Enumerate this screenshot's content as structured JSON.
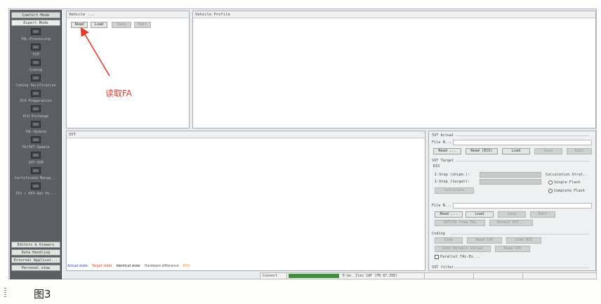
{
  "nav": {
    "modes": [
      "Comfort Mode",
      "Expert Mode"
    ],
    "items": [
      "TAL-Processing",
      "FCM",
      "Coding",
      "Coding Verification",
      "ECU Preparation",
      "ECU Exchange",
      "TAL-Update",
      "FA/SVT-Update",
      "SVT-VCM",
      "Certificate Manag...",
      "IPs / KPS-Ads Hs..."
    ],
    "footer": [
      "Editors & Viewers",
      "Data Handling",
      "External Applicat...",
      "Personal view"
    ]
  },
  "vehicle": {
    "title": "Vehicle ...",
    "buttons": {
      "read": "Read",
      "load": "Load",
      "save": "Save",
      "edit": "Edit"
    }
  },
  "profile": {
    "title": "Vehicle Profile"
  },
  "svt": {
    "title": "SVT"
  },
  "right_panel": {
    "svt_actual": {
      "title": "SVT Actual",
      "file_label": "File N...",
      "buttons": [
        "Read ...",
        "Read (ECU)",
        "Load",
        "Save",
        "Edit"
      ]
    },
    "svt_target": {
      "title": "SVT Target",
      "kis_label": "KIS",
      "istep_shipm": "I-Step (shipm.):",
      "istep_target": "I-Step (target):",
      "calculate": "Calculate",
      "strategy_title": "Calculation Strat..",
      "strategy_options": [
        "Single Flash",
        "Complete Flash"
      ],
      "file_label": "File N...",
      "buttons": [
        "Read ...",
        "Load",
        "Save",
        "Edit"
      ],
      "extra_buttons": [
        "SVT/FA from TAL",
        "Detect SVT..."
      ]
    },
    "coding": {
      "title": "Coding",
      "buttons": [
        "Code",
        "Read CAF",
        "Code NCD"
      ],
      "buttons2": [
        "Code Default Values",
        "Read CPS"
      ],
      "parallel_label": "Parallel TAL-Ex..."
    },
    "filter_title": "SVT filter"
  },
  "legend": [
    {
      "label": "Actual state",
      "color": "#2a3fd0"
    },
    {
      "label": "Target state",
      "color": "#e03a2a"
    },
    {
      "label": "Identical state",
      "color": "#222222"
    },
    {
      "label": "Hardware difference",
      "color": "#6a6a6a"
    },
    {
      "label": "HSV",
      "color": "#f08a20"
    }
  ],
  "status": {
    "connect": "Connect",
    "vehicle": "E-Ge. Zlev CAF (FB 87.35E)"
  },
  "annotation": "读取FA",
  "caption": "图3"
}
